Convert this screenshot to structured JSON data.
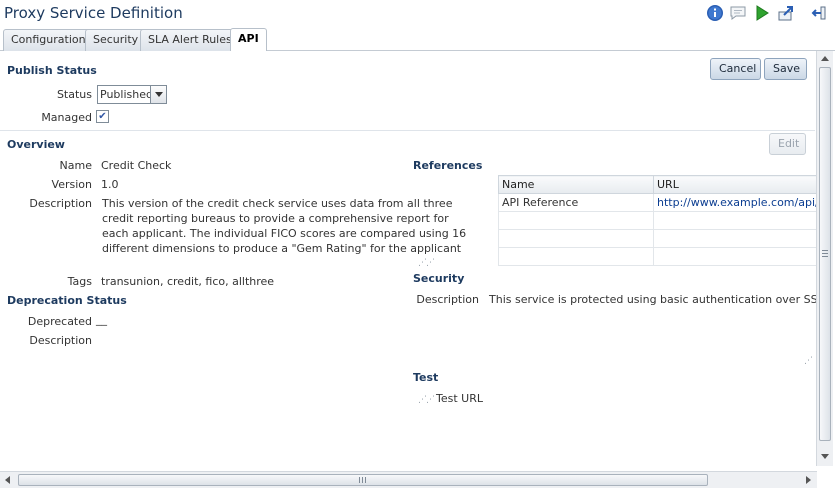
{
  "header": {
    "title": "Proxy Service Definition",
    "icons": [
      "info-icon",
      "comment-icon",
      "run-icon",
      "export-icon",
      "exit-icon"
    ]
  },
  "tabs": [
    {
      "label": "Configuration",
      "active": false
    },
    {
      "label": "Security",
      "active": false
    },
    {
      "label": "SLA Alert Rules",
      "active": false
    },
    {
      "label": "API",
      "active": true
    }
  ],
  "actions": {
    "cancel_label": "Cancel",
    "save_label": "Save",
    "edit_label": "Edit"
  },
  "publish_status": {
    "title": "Publish Status",
    "status_label": "Status",
    "status_value": "Published",
    "managed_label": "Managed",
    "managed_checked": true
  },
  "overview": {
    "title": "Overview",
    "name_label": "Name",
    "name_value": "Credit Check",
    "version_label": "Version",
    "version_value": "1.0",
    "description_label": "Description",
    "description_lines": [
      "This version of the credit check service uses data from all three",
      "credit reporting bureaus to provide a comprehensive report for",
      "each applicant.  The individual FICO scores are compared using 16",
      "different dimensions to produce a \"Gem Rating\" for the applicant"
    ],
    "tags_label": "Tags",
    "tags_value": "transunion, credit, fico, allthree"
  },
  "deprecation": {
    "title": "Deprecation Status",
    "deprecated_label": "Deprecated",
    "deprecated_value": "__",
    "description_label": "Description"
  },
  "references": {
    "title": "References",
    "columns": [
      "Name",
      "URL"
    ],
    "rows": [
      {
        "name": "API Reference",
        "url": "http://www.example.com/api/cre"
      },
      {
        "name": "",
        "url": ""
      },
      {
        "name": "",
        "url": ""
      },
      {
        "name": "",
        "url": ""
      }
    ]
  },
  "security": {
    "title": "Security",
    "description_label": "Description",
    "description_value": "This service is protected using basic authentication over SSL"
  },
  "test": {
    "title": "Test",
    "url_label": "Test URL"
  },
  "colors": {
    "accent": "#1d3a5f",
    "link": "#0b3d91"
  }
}
